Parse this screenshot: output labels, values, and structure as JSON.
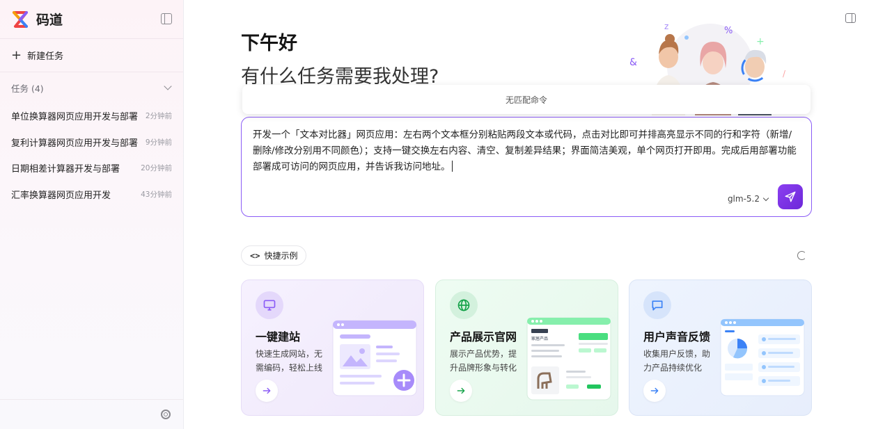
{
  "sidebar": {
    "brand": "码道",
    "new_task_label": "新建任务",
    "section_title": "任务 (4)",
    "tasks": [
      {
        "title": "单位换算器网页应用开发与部署",
        "time": "2分钟前"
      },
      {
        "title": "复利计算器网页应用开发与部署",
        "time": "9分钟前"
      },
      {
        "title": "日期相差计算器开发与部署",
        "time": "20分钟前"
      },
      {
        "title": "汇率换算器网页应用开发",
        "time": "43分钟前"
      }
    ]
  },
  "main": {
    "greeting": "下午好",
    "subtitle": "有什么任务需要我处理?",
    "command_popup": "无匹配命令",
    "composer": {
      "text": "开发一个「文本对比器」网页应用：左右两个文本框分别粘贴两段文本或代码，点击对比即可并排高亮显示不同的行和字符（新增/删除/修改分别用不同颜色）；支持一键交换左右内容、清空、复制差异结果；界面简洁美观，单个网页打开即用。完成后用部署功能部署成可访问的网页应用，并告诉我访问地址。",
      "model": "glm-5.2"
    },
    "quick_examples_label": "快捷示例",
    "cards": [
      {
        "title": "一键建站",
        "desc": "快速生成网站，无需编码，轻松上线",
        "icon": "monitor-icon",
        "accent": "#8b5cf6"
      },
      {
        "title": "产品展示官网",
        "desc": "展示产品优势，提升品牌形象与转化",
        "icon": "globe-icon",
        "accent": "#16a34a"
      },
      {
        "title": "用户声音反馈",
        "desc": "收集用户反馈，助力产品持续优化",
        "icon": "chat-icon",
        "accent": "#3b82f6"
      }
    ],
    "card_art_text": {
      "product_name": "家居产品"
    }
  },
  "colors": {
    "accent": "#7c3aed",
    "sidebar_bg": "#fdf3f7"
  }
}
